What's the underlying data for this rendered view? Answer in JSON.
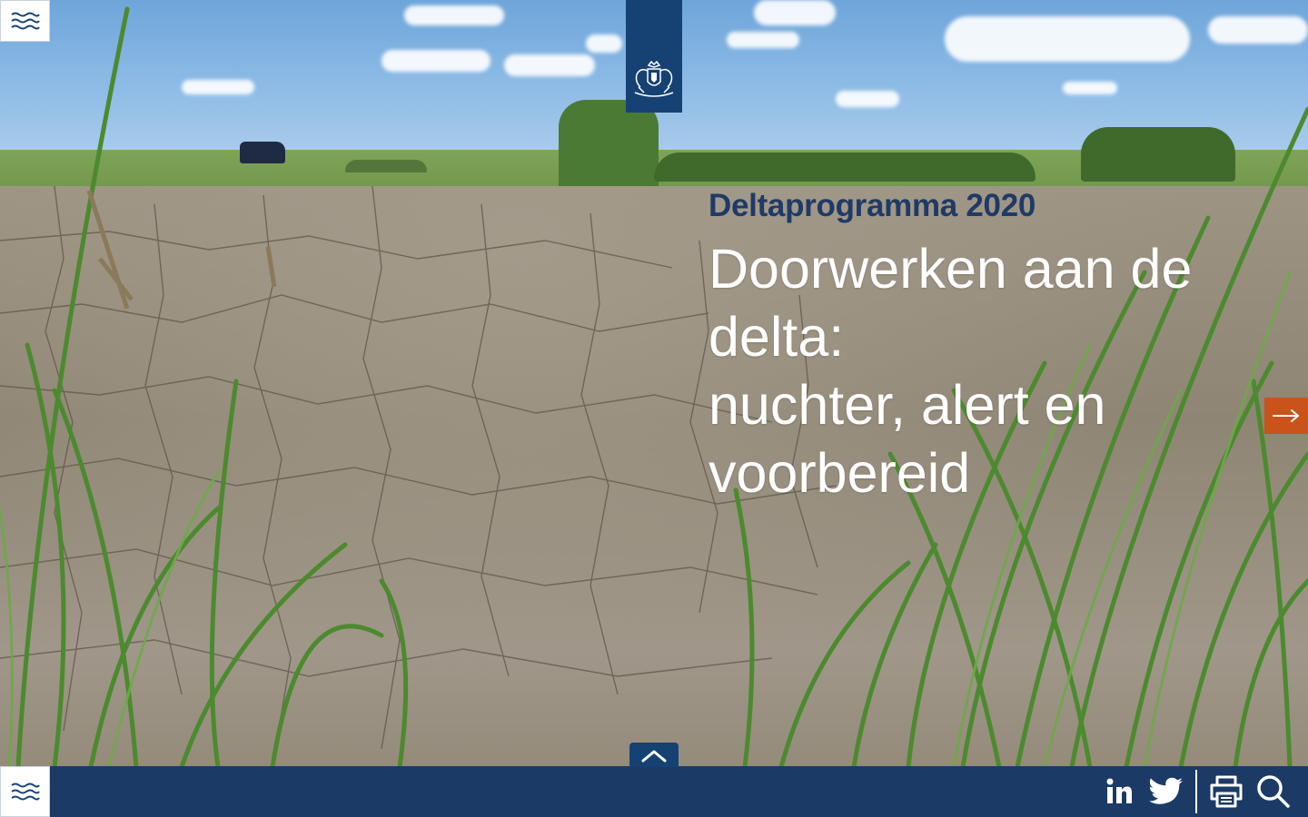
{
  "header": {
    "menu_icon": "waves-menu-icon",
    "logo_icon": "coat-of-arms-icon"
  },
  "hero": {
    "kicker": "Deltaprogramma 2020",
    "headline_lines": [
      "Doorwerken aan de",
      "delta:",
      "nuchter, alert en",
      "voorbereid"
    ],
    "image_description_icon": "dry-riverbed-photo"
  },
  "navigation": {
    "next_icon": "arrow-right-icon",
    "up_icon": "chevron-up-icon"
  },
  "footer": {
    "menu_icon": "waves-menu-icon",
    "tools": [
      {
        "icon": "linkedin-icon"
      },
      {
        "icon": "twitter-icon"
      },
      {
        "icon": "print-icon"
      },
      {
        "icon": "search-icon"
      }
    ]
  },
  "colors": {
    "brand_blue": "#154273",
    "bar_blue": "#1b3a66",
    "accent_orange": "#c9531a",
    "kicker_blue": "#1f3a66"
  }
}
